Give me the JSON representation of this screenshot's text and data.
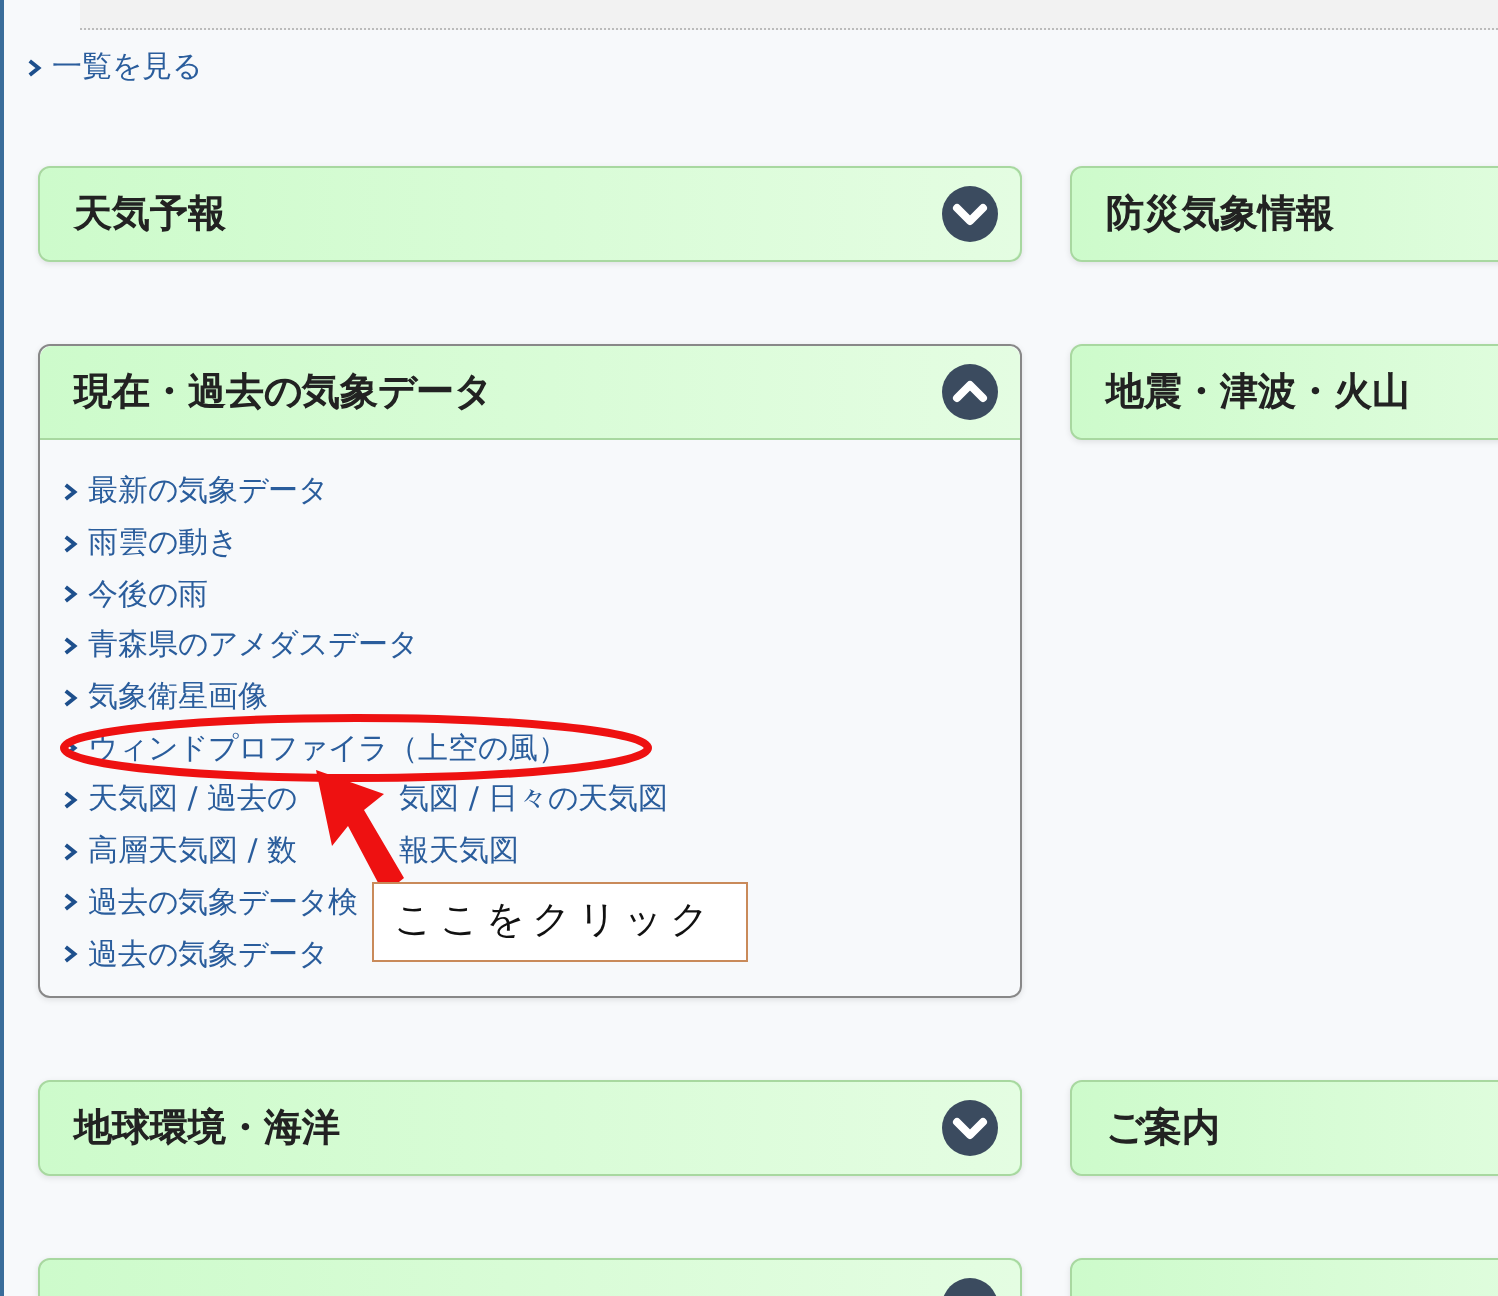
{
  "list_link": {
    "text": "一覧を見る"
  },
  "panels": [
    {
      "title": "天気予報",
      "expanded": false
    },
    {
      "title": "防災気象情報",
      "expanded": false
    },
    {
      "title": "現在・過去の気象データ",
      "expanded": true,
      "links": [
        {
          "text": "最新の気象データ"
        },
        {
          "text": "雨雲の動き"
        },
        {
          "text": "今後の雨"
        },
        {
          "text": "青森県のアメダスデータ"
        },
        {
          "text": "気象衛星画像"
        },
        {
          "text": "ウィンドプロファイラ（上空の風）",
          "circled": true
        },
        {
          "text": "天気図 / 過去の",
          "after": "気図 / 日々の天気図"
        },
        {
          "text": "高層天気図 / 数",
          "after": "報天気図"
        },
        {
          "text": "過去の気象データ検"
        },
        {
          "text": "過去の気象データ"
        }
      ]
    },
    {
      "title": "地震・津波・火山",
      "expanded": false
    },
    {
      "title": "地球環境・海洋",
      "expanded": false
    },
    {
      "title": "ご案内",
      "expanded": false
    },
    {
      "expanded": false
    },
    {
      "expanded": false
    }
  ],
  "callout": {
    "text": "ここをクリック"
  }
}
